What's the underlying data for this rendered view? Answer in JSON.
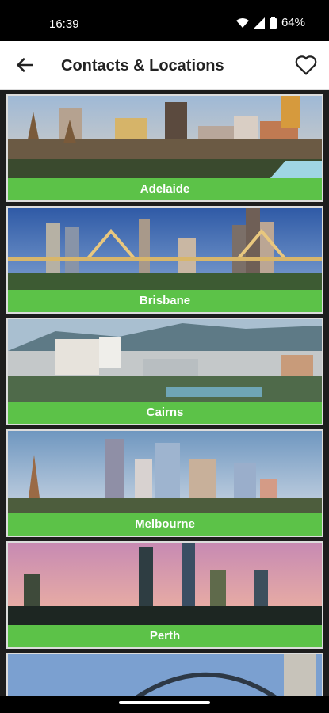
{
  "status": {
    "time": "16:39",
    "battery": "64%"
  },
  "header": {
    "title": "Contacts & Locations"
  },
  "icons": {
    "back": "back-arrow-icon",
    "favorite": "heart-outline-icon"
  },
  "cities": [
    {
      "name": "Adelaide"
    },
    {
      "name": "Brisbane"
    },
    {
      "name": "Cairns"
    },
    {
      "name": "Melbourne"
    },
    {
      "name": "Perth"
    },
    {
      "name": ""
    }
  ],
  "colors": {
    "caption_green": "#5cc248"
  }
}
